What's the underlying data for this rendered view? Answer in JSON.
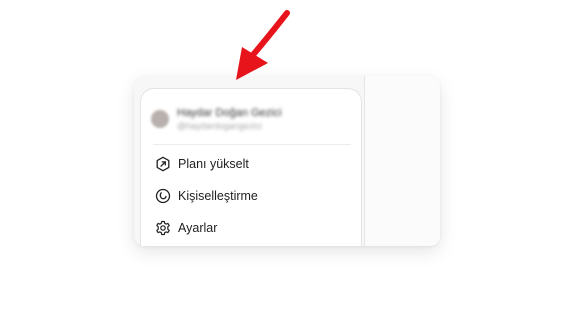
{
  "annotation": {
    "arrow_color": "#e8141b"
  },
  "user": {
    "name": "Haydar Doğan Gezici",
    "handle": "@haydardogangezici",
    "avatar_color": "#b8b0ac"
  },
  "menu": {
    "items": [
      {
        "label": "Planı yükselt",
        "icon": "upgrade-plan-icon"
      },
      {
        "label": "Kişiselleştirme",
        "icon": "personalization-icon"
      },
      {
        "label": "Ayarlar",
        "icon": "settings-gear-icon"
      }
    ]
  }
}
